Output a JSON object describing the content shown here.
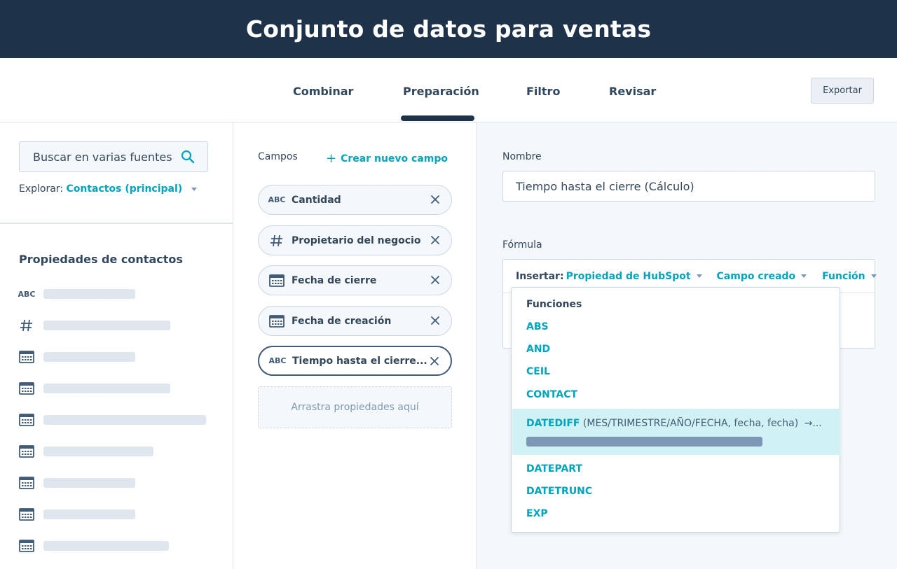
{
  "header": {
    "title": "Conjunto de datos para ventas"
  },
  "tabs": [
    {
      "label": "Combinar"
    },
    {
      "label": "Preparación"
    },
    {
      "label": "Filtro"
    },
    {
      "label": "Revisar"
    }
  ],
  "active_tab": "Preparación",
  "toolbar": {
    "export_label": "Exportar"
  },
  "left_panel": {
    "search_placeholder": "Buscar en varias fuentes",
    "explore_label": "Explorar:",
    "explore_value": "Contactos (principal)",
    "properties_title": "Propiedades de contactos",
    "property_icons": [
      "abc-icon",
      "hash-icon",
      "calendar-icon",
      "calendar-icon",
      "calendar-icon",
      "calendar-icon",
      "calendar-icon",
      "calendar-icon",
      "calendar-icon"
    ]
  },
  "fields_panel": {
    "label": "Campos",
    "create_label": "Crear nuevo campo",
    "fields": [
      {
        "icon": "abc-icon",
        "label": "Cantidad"
      },
      {
        "icon": "hash-icon",
        "label": "Propietario del negocio"
      },
      {
        "icon": "calendar-icon",
        "label": "Fecha de cierre"
      },
      {
        "icon": "calendar-icon",
        "label": "Fecha de creación"
      },
      {
        "icon": "abc-icon",
        "label": "Tiempo hasta el cierre..."
      }
    ],
    "dropzone_label": "Arrastra propiedades aquí"
  },
  "editor": {
    "name_label": "Nombre",
    "name_value": "Tiempo hasta el cierre (Cálculo)",
    "formula_label": "Fórmula",
    "insert_label": "Insertar:",
    "insert_options": [
      "Propiedad de HubSpot",
      "Campo creado",
      "Función"
    ]
  },
  "functions_dropdown": {
    "title": "Funciones",
    "items_before": [
      "ABS",
      "AND",
      "CEIL",
      "CONTACT"
    ],
    "highlighted": {
      "name": "DATEDIFF",
      "args": "(MES/TRIMESTRE/AÑO/FECHA, fecha, fecha)",
      "suffix": "→..."
    },
    "items_after": [
      "DATEPART",
      "DATETRUNC",
      "EXP"
    ]
  },
  "colors": {
    "header_bg": "#1e3349",
    "accent": "#00a4bd",
    "highlight": "#d1f2f5"
  }
}
